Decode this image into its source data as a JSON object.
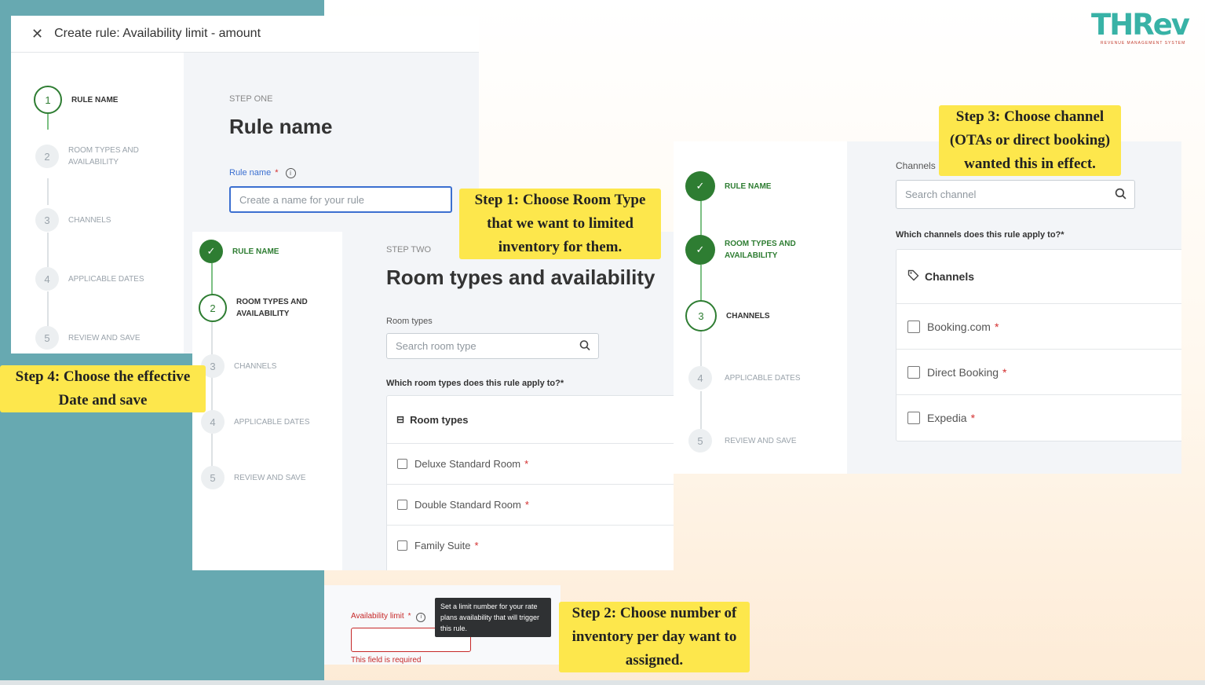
{
  "logo": {
    "text": "THRev",
    "tagline": "REVENUE MANAGEMENT SYSTEM"
  },
  "steps": [
    "RULE NAME",
    "ROOM TYPES AND AVAILABILITY",
    "CHANNELS",
    "APPLICABLE DATES",
    "REVIEW AND SAVE"
  ],
  "panel1": {
    "title": "Create rule: Availability limit - amount",
    "step_caption": "STEP ONE",
    "heading": "Rule name",
    "field_label": "Rule name",
    "input_placeholder": "Create a name for your rule"
  },
  "panel2": {
    "step_caption": "STEP TWO",
    "heading": "Room types and availability",
    "search_label": "Room types",
    "search_placeholder": "Search room type",
    "question": "Which room types does this rule apply to?*",
    "table_header": "Room types",
    "rooms": [
      "Deluxe Standard Room",
      "Double Standard Room",
      "Family Suite"
    ]
  },
  "panel3": {
    "search_label": "Channels",
    "search_placeholder": "Search channel",
    "question": "Which channels does this rule apply to?*",
    "table_header": "Channels",
    "channels": [
      "Booking.com",
      "Direct Booking",
      "Expedia"
    ]
  },
  "panel4": {
    "field_label": "Availability limit",
    "tooltip": "Set a limit number for your rate plans availability that will trigger this rule.",
    "error": "This field is required"
  },
  "callouts": {
    "step1": "Step 1: Choose Room Type that we want to limited inventory for them.",
    "step1_lines": [
      "Step 1: Choose Room Type",
      "that we want to limited",
      "inventory for them."
    ],
    "step2_lines": [
      "Step 2: Choose number of",
      "inventory per day want to",
      "assigned."
    ],
    "step3_lines": [
      "Step 3: Choose channel",
      "(OTAs or direct booking)",
      "wanted this in effect."
    ],
    "step4_lines": [
      "Step 4: Choose the effective",
      "Date and save"
    ]
  },
  "colors": {
    "teal": "#67a9b1",
    "callout": "#fde74c",
    "green": "#2e7d32",
    "required": "#d32f2f"
  }
}
